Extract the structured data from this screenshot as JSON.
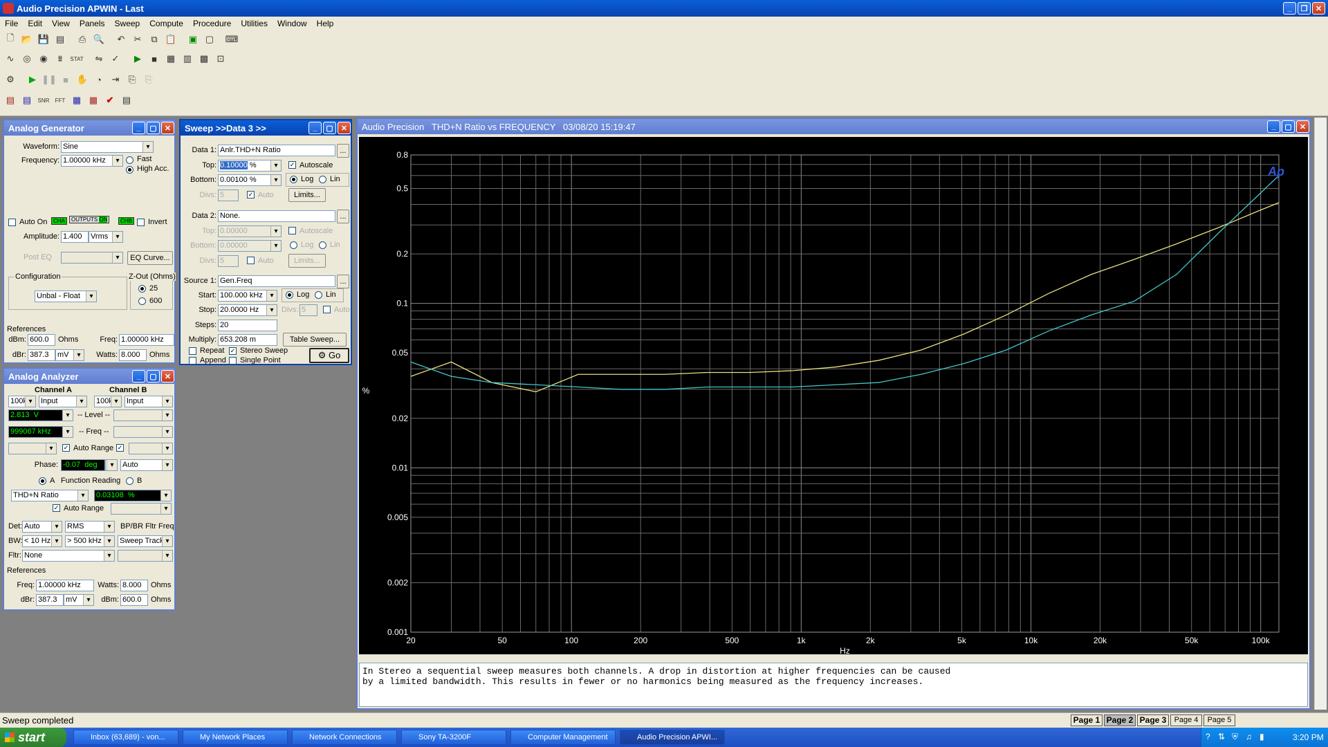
{
  "app": {
    "title": "Audio Precision APWIN - Last",
    "menu": [
      "File",
      "Edit",
      "View",
      "Panels",
      "Sweep",
      "Compute",
      "Procedure",
      "Utilities",
      "Window",
      "Help"
    ]
  },
  "generator": {
    "title": "Analog Generator",
    "waveform_label": "Waveform:",
    "waveform": "Sine",
    "frequency_label": "Frequency:",
    "frequency": "1.00000 kHz",
    "fast": "Fast",
    "high_acc": "High Acc.",
    "auto_on": "Auto On",
    "cha": "CHA",
    "outputs": "OUTPUTS",
    "on": "ON",
    "chb": "CHB",
    "invert": "Invert",
    "amplitude_label": "Amplitude:",
    "amplitude": "1.400",
    "amplitude_unit": "Vrms",
    "post_eq": "Post EQ",
    "eq_curve": "EQ Curve...",
    "configuration": "Configuration",
    "config_value": "Unbal - Float",
    "zout": "Z-Out (Ohms)",
    "z25": "25",
    "z600": "600",
    "references": "References",
    "dbm_label": "dBm:",
    "dbm": "600.0",
    "dbm_unit": "Ohms",
    "freq_label": "Freq:",
    "freq": "1.00000 kHz",
    "dbr_label": "dBr:",
    "dbr": "387.3",
    "dbr_unit": "mV",
    "watts_label": "Watts:",
    "watts": "8.000",
    "watts_unit": "Ohms"
  },
  "analyzer": {
    "title": "Analog Analyzer",
    "cha": "Channel A",
    "chb": "Channel B",
    "a_range": "100k",
    "a_input": "Input",
    "b_range": "100k",
    "b_input": "Input",
    "a_level": "2.813",
    "a_level_unit": "V",
    "level_lbl": "-- Level --",
    "a_freq": "999067 kHz",
    "freq_lbl": "-- Freq --",
    "auto_range": "Auto Range",
    "phase_label": "Phase:",
    "phase": "-0.07",
    "phase_unit": "deg",
    "phase_mode": "Auto",
    "radio_a": "A",
    "function_reading": "Function Reading",
    "radio_b": "B",
    "function": "THD+N Ratio",
    "reading": "0.03108",
    "reading_unit": "%",
    "auto_range2": "Auto Range",
    "det_label": "Det:",
    "det": "Auto",
    "det_mode": "RMS",
    "bp_br": "BP/BR Fltr Freq",
    "bw_label": "BW:",
    "bw_lo": "< 10 Hz",
    "bw_hi": "> 500 kHz",
    "sweep_track": "Sweep Track",
    "fltr_label": "Fltr:",
    "fltr": "None",
    "references": "References",
    "freq_label": "Freq:",
    "freq": "1.00000 kHz",
    "watts_label": "Watts:",
    "watts": "8.000",
    "watts_unit": "Ohms",
    "dbr_label": "dBr:",
    "dbr": "387.3",
    "dbr_unit": "mV",
    "dbm_label": "dBm:",
    "dbm": "600.0",
    "dbm_unit": "Ohms"
  },
  "sweep": {
    "title": "Sweep  >>Data 3 >>",
    "data1_label": "Data 1:",
    "data1": "Anlr.THD+N Ratio",
    "top_label": "Top:",
    "top": "0.10000",
    "top_unit": "%",
    "autoscale": "Autoscale",
    "bottom_label": "Bottom:",
    "bottom": "0.00100",
    "bottom_unit": "%",
    "log": "Log",
    "lin": "Lin",
    "divs_label": "Divs:",
    "divs": "5",
    "auto": "Auto",
    "limits": "Limits...",
    "data2_label": "Data 2:",
    "data2": "None.",
    "top2": "0.00000",
    "bottom2": "0.00000",
    "divs2": "5",
    "source1_label": "Source 1:",
    "source1": "Gen.Freq",
    "start_label": "Start:",
    "start": "100.000 kHz",
    "stop_label": "Stop:",
    "stop": "20.0000",
    "stop_unit": "Hz",
    "steps_label": "Steps:",
    "steps": "20",
    "multiply_label": "Multiply:",
    "multiply": "653.208 m",
    "table_sweep": "Table Sweep...",
    "repeat": "Repeat",
    "stereo_sweep": "Stereo Sweep",
    "append": "Append",
    "single_point": "Single Point",
    "go": "Go"
  },
  "graph_window": {
    "title": "Audio Precision   THD+N Ratio vs FREQUENCY   03/08/20 15:19:47",
    "ap_logo": "Ap",
    "note_line1": "In Stereo a sequential sweep measures both channels.  A drop in distortion at higher frequencies can be caused",
    "note_line2": "by a limited bandwidth.  This results in fewer or no harmonics being measured as the frequency increases."
  },
  "chart_data": {
    "type": "line",
    "title": "THD+N Ratio vs FREQUENCY",
    "xlabel": "Hz",
    "ylabel": "%",
    "x_scale": "log",
    "y_scale": "log",
    "xlim": [
      20,
      120000
    ],
    "ylim": [
      0.001,
      0.8
    ],
    "x_ticks": [
      20,
      50,
      100,
      200,
      500,
      1000,
      2000,
      5000,
      10000,
      20000,
      50000,
      100000
    ],
    "x_tick_labels": [
      "20",
      "50",
      "100",
      "200",
      "500",
      "1k",
      "2k",
      "5k",
      "10k",
      "20k",
      "50k",
      "100k"
    ],
    "y_ticks": [
      0.8,
      0.5,
      0.2,
      0.1,
      0.05,
      0.02,
      0.01,
      0.005,
      0.002,
      0.001
    ],
    "y_tick_labels": [
      "0.8",
      "0.5",
      "0.2",
      "0.1",
      "0.05",
      "0.02",
      "0.01",
      "0.005",
      "0.002",
      "0.001"
    ],
    "grid": true,
    "background": "#000000",
    "series": [
      {
        "color": "#e8e27a",
        "x": [
          20,
          30,
          45,
          70,
          107,
          165,
          255,
          390,
          600,
          920,
          1410,
          2170,
          3320,
          5090,
          7800,
          11960,
          18300,
          28100,
          43000,
          65900,
          100000,
          120000
        ],
        "y": [
          0.036,
          0.044,
          0.033,
          0.029,
          0.037,
          0.037,
          0.037,
          0.038,
          0.038,
          0.039,
          0.041,
          0.045,
          0.052,
          0.065,
          0.085,
          0.115,
          0.15,
          0.185,
          0.23,
          0.29,
          0.37,
          0.41
        ]
      },
      {
        "color": "#45c8cc",
        "x": [
          20,
          30,
          45,
          70,
          107,
          165,
          255,
          390,
          600,
          920,
          1410,
          2170,
          3320,
          5090,
          7800,
          11960,
          18300,
          28100,
          43000,
          65900,
          100000,
          120000
        ],
        "y": [
          0.044,
          0.036,
          0.033,
          0.032,
          0.031,
          0.03,
          0.03,
          0.031,
          0.031,
          0.031,
          0.032,
          0.033,
          0.037,
          0.043,
          0.052,
          0.068,
          0.085,
          0.103,
          0.15,
          0.27,
          0.47,
          0.6
        ]
      }
    ]
  },
  "status": {
    "text": "Sweep completed"
  },
  "pages": [
    "Page 1",
    "Page 2",
    "Page 3",
    "Page 4",
    "Page 5"
  ],
  "taskbar": {
    "start": "start",
    "tasks": [
      "Inbox (63,689) - von...",
      "My Network Places",
      "Network Connections",
      "Sony TA-3200F",
      "Computer Management",
      "Audio Precision APWI..."
    ],
    "clock": "3:20 PM"
  }
}
